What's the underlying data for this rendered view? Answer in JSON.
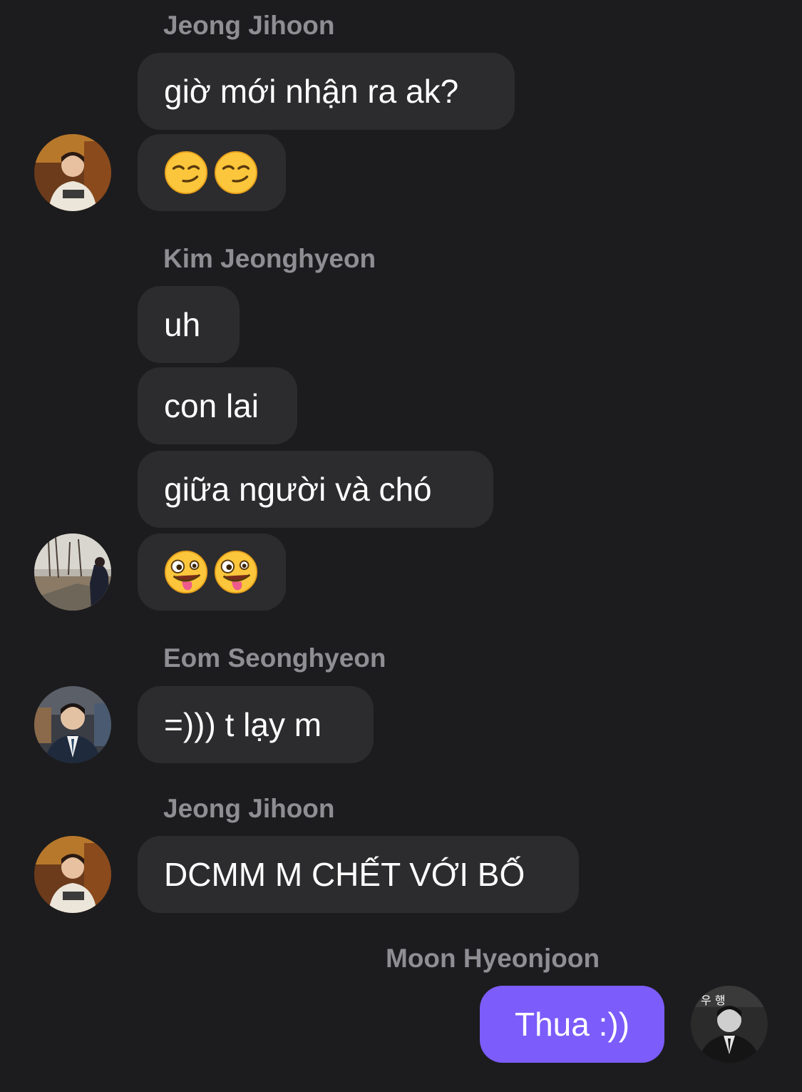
{
  "messages": [
    {
      "sender": "Jeong Jihoon",
      "texts": [
        "giờ mới nhận ra ak?"
      ],
      "emoji": [
        "smirk",
        "smirk"
      ],
      "avatar": "jihoon-avatar"
    },
    {
      "sender": "Kim Jeonghyeon",
      "texts": [
        "uh",
        "con lai",
        "giữa người và chó"
      ],
      "emoji": [
        "zany-face",
        "zany-face"
      ],
      "avatar": "jeonghyeon-avatar"
    },
    {
      "sender": "Eom Seonghyeon",
      "texts": [
        "=))) t lạy m"
      ],
      "avatar": "seonghyeon-avatar"
    },
    {
      "sender": "Jeong Jihoon",
      "texts": [
        "DCMM M CHẾT VỚI BỐ"
      ],
      "avatar": "jihoon-avatar"
    },
    {
      "sender": "Moon Hyeonjoon",
      "texts": [
        "Thua :))"
      ],
      "outgoing": true,
      "avatar": "hyeonjoon-avatar",
      "avatar_caption": "우 행"
    }
  ],
  "colors": {
    "background": "#1c1c1e",
    "incoming_bubble": "#2c2c2e",
    "outgoing_bubble": "#7c5cfa",
    "sender_name": "#8e8e93"
  }
}
